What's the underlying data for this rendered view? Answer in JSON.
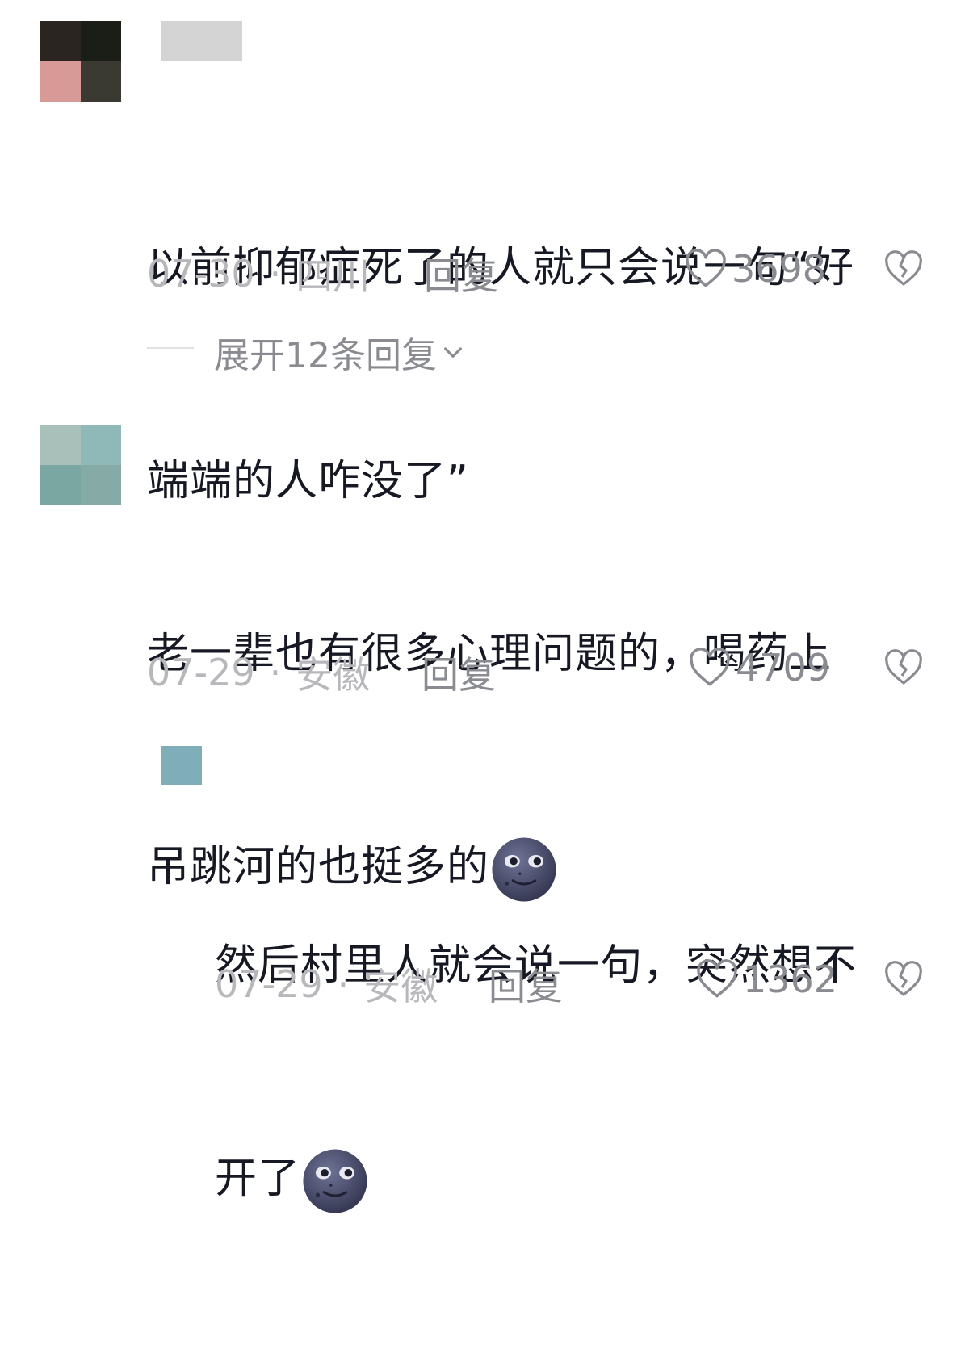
{
  "comments": [
    {
      "avatar_colors": [
        "#2a2521",
        "#1b1d17",
        "#d79a97",
        "#3a3a33"
      ],
      "text_lines": [
        "以前抑郁症死了的人就只会说一句“好",
        "端端的人咋没了”"
      ],
      "date": "07-30",
      "location": "四川",
      "reply_label": "回复",
      "likes": "3698",
      "expand_label": "展开12条回复"
    },
    {
      "avatar_colors": [
        "#a8c0b9",
        "#8fb9b9",
        "#7aa7a2",
        "#86aaa6"
      ],
      "text_lines": [
        "老一辈也有很多心理问题的，喝药上",
        "吊跳河的也挺多的"
      ],
      "date": "07-29",
      "location": "安徽",
      "reply_label": "回复",
      "likes": "4709"
    },
    {
      "avatar_colors": [
        "#7faeb8"
      ],
      "text_lines": [
        "然后村里人就会说一句，突然想不",
        "开了"
      ],
      "date": "07-29",
      "location": "安徽",
      "reply_label": "回复",
      "likes": "1362"
    }
  ],
  "separator": "·",
  "icons": {
    "heart": "heart-outline-icon",
    "dislike": "broken-heart-icon",
    "emoji": "new-moon-face-emoji",
    "chevron": "chevron-down-icon"
  }
}
